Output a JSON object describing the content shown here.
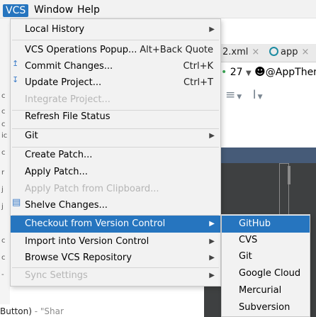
{
  "menubar": {
    "items": [
      "VCS",
      "Window",
      "Help"
    ]
  },
  "vcs_menu": {
    "items": [
      {
        "label": "Local History",
        "submenu": true,
        "enabled": true
      },
      {
        "label": "VCS Operations Popup...",
        "shortcut": "Alt+Back Quote",
        "enabled": true
      },
      {
        "label": "Commit Changes...",
        "shortcut": "Ctrl+K",
        "enabled": true,
        "icon": "commit-icon"
      },
      {
        "label": "Update Project...",
        "shortcut": "Ctrl+T",
        "enabled": true,
        "icon": "update-icon"
      },
      {
        "label": "Integrate Project...",
        "enabled": false
      },
      {
        "label": "Refresh File Status",
        "enabled": true
      },
      {
        "label": "Git",
        "submenu": true,
        "enabled": true
      },
      {
        "label": "Create Patch...",
        "enabled": true
      },
      {
        "label": "Apply Patch...",
        "enabled": true
      },
      {
        "label": "Apply Patch from Clipboard...",
        "enabled": false
      },
      {
        "label": "Shelve Changes...",
        "enabled": true,
        "icon": "shelve-icon"
      },
      {
        "label": "Checkout from Version Control",
        "submenu": true,
        "enabled": true,
        "selected": true
      },
      {
        "label": "Import into Version Control",
        "submenu": true,
        "enabled": true
      },
      {
        "label": "Browse VCS Repository",
        "submenu": true,
        "enabled": true
      },
      {
        "label": "Sync Settings",
        "submenu": true,
        "enabled": false
      }
    ]
  },
  "checkout_submenu": {
    "items": [
      {
        "label": "GitHub",
        "selected": true
      },
      {
        "label": "CVS"
      },
      {
        "label": "Git"
      },
      {
        "label": "Google Cloud"
      },
      {
        "label": "Mercurial"
      },
      {
        "label": "Subversion"
      }
    ]
  },
  "background": {
    "tab1": "2.xml",
    "tab2": "app",
    "row2_number": "27",
    "row2_theme": "@AppThen",
    "bottom_text_prefix": "Button)",
    "bottom_text_suffix": " - \"Shar",
    "gutter_chars": [
      "c",
      "c",
      "c",
      "ic",
      "c",
      "r",
      "j",
      "j",
      "c",
      "c",
      "-"
    ]
  },
  "colors": {
    "menu_bg": "#f2f2f2",
    "selection": "#2675bf",
    "disabled_text": "#b5b5b5",
    "dark_panel": "#3e4041"
  }
}
